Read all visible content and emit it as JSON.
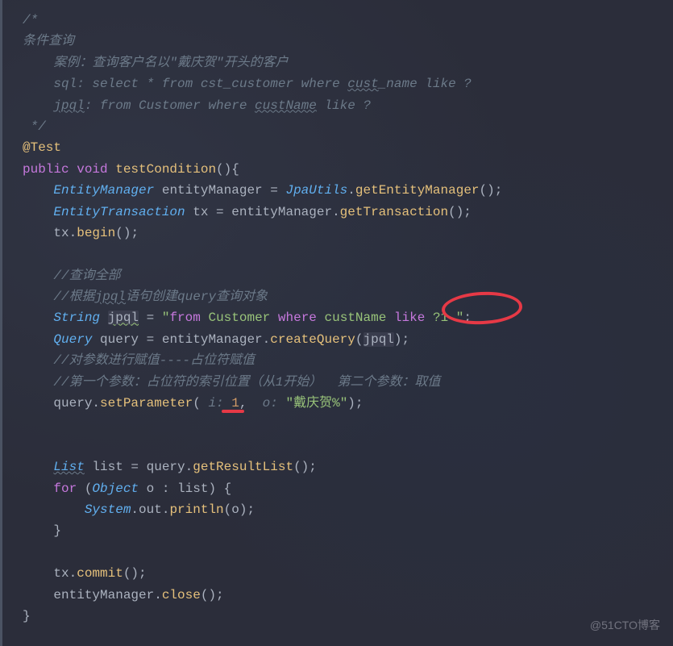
{
  "watermark": "@51CTO博客",
  "lines": {
    "l0": "/*",
    "l1": "条件查询",
    "l2": "    案例：查询客户名以\"戴庆贺\"开头的客户",
    "l3_pre": "    sql: select * from cst_customer where ",
    "l3_cust": "cust",
    "l3_post": "_name like ?",
    "l4_pre": "    ",
    "l4_jpql": "jpql",
    "l4_mid": ": from Customer where ",
    "l4_custname": "custName",
    "l4_post": " like ?",
    "l5": " */",
    "l6_annotation": "@Test",
    "l7_public": "public",
    "l7_void": " void ",
    "l7_method": "testCondition",
    "l7_end": "(){",
    "l8_type": "EntityManager",
    "l8_var": " entityManager = ",
    "l8_class": "JpaUtils",
    "l8_dot": ".",
    "l8_method": "getEntityManager",
    "l8_end": "();",
    "l9_type": "EntityTransaction",
    "l9_var": " tx = entityManager.",
    "l9_method": "getTransaction",
    "l9_end": "();",
    "l10_pre": "tx.",
    "l10_method": "begin",
    "l10_end": "();",
    "l12": "//查询全部",
    "l13_pre": "//根据",
    "l13_jpql": "jpql",
    "l13_post": "语句创建query查询对象",
    "l14_type": "String",
    "l14_sp": " ",
    "l14_var": "jpql",
    "l14_eq": " = ",
    "l14_q1": "\"",
    "l14_from": "from",
    "l14_sp2": " ",
    "l14_cust": "Customer",
    "l14_sp3": " ",
    "l14_where": "where",
    "l14_mid": " custName ",
    "l14_like": "like",
    "l14_sp4": " ",
    "l14_param": "?1",
    "l14_sp5": " ",
    "l14_q2": "\"",
    "l14_end": ";",
    "l15_type": "Query",
    "l15_var": " query = entityManager.",
    "l15_method": "createQuery",
    "l15_p1": "(",
    "l15_arg": "jpql",
    "l15_p2": ")",
    "l15_end": ";",
    "l16": "//对参数进行赋值----占位符赋值",
    "l17": "//第一个参数：占位符的索引位置（从1开始）  第二个参数：取值",
    "l18_pre": "query.",
    "l18_method": "setParameter",
    "l18_p1": "(",
    "l18_h1": " i: ",
    "l18_n": "1",
    "l18_c": ",",
    "l18_h2": "  o: ",
    "l18_str": "\"戴庆贺%\"",
    "l18_p2": ")",
    "l18_end": ";",
    "l21_type": "List",
    "l21_var": " list = query.",
    "l21_method": "getResultList",
    "l21_end": "();",
    "l22_for": "for",
    "l22_sp": " (",
    "l22_obj": "Object",
    "l22_mid": " o : list",
    "l22_p": ")",
    "l22_b": " {",
    "l23_sys": "System",
    "l23_mid": ".out.",
    "l23_method": "println",
    "l23_p1": "(",
    "l23_arg": "o",
    "l23_p2": ")",
    "l23_end": ";",
    "l24": "}",
    "l26_pre": "tx.",
    "l26_method": "commit",
    "l26_end": "();",
    "l27_pre": "entityManager.",
    "l27_method": "close",
    "l27_end": "();",
    "l28": "}"
  }
}
